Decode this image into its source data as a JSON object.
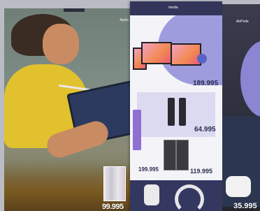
{
  "prices": {
    "left_page": "99.995",
    "middle_top": "189.995",
    "middle_center": "64.995",
    "middle_bottom_right": "119.995",
    "middle_bottom_left": "199.995",
    "right_page": "35.995"
  },
  "brand": {
    "left_page_label": "Apple",
    "right_page_label": "AirPods",
    "middle_logo": "media"
  },
  "colors": {
    "accent_purple": "#8a86d6",
    "navy": "#33365a",
    "sweater_yellow": "#e1c12e"
  }
}
